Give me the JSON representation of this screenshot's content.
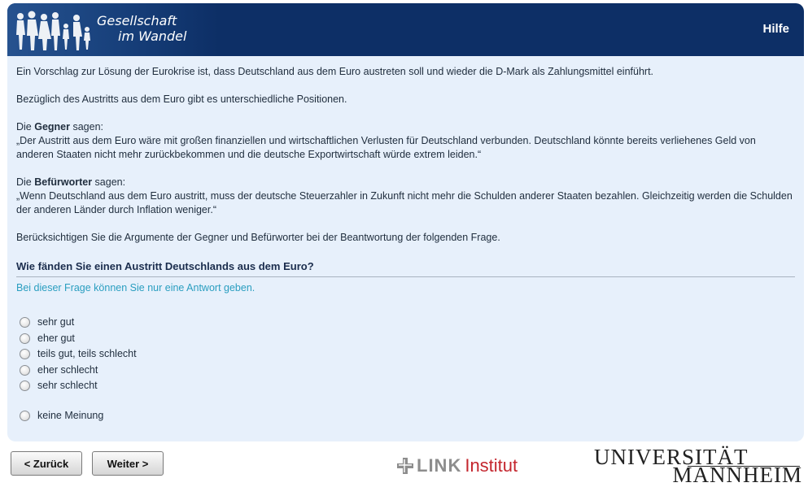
{
  "header": {
    "logo_line1": "Gesellschaft",
    "logo_line2": "im Wandel",
    "help_label": "Hilfe"
  },
  "intro": {
    "p1": "Ein Vorschlag zur Lösung der Eurokrise ist, dass Deutschland aus dem Euro austreten soll und wieder die D-Mark als Zahlungsmittel einführt.",
    "p2": "Bezüglich des Austritts aus dem Euro gibt es unterschiedliche Positionen.",
    "gegner_prefix": "Die ",
    "gegner_bold": "Gegner",
    "gegner_suffix": " sagen:",
    "gegner_quote": "„Der Austritt aus dem Euro wäre mit großen finanziellen und wirtschaftlichen Verlusten für Deutschland verbunden. Deutschland könnte bereits verliehenes Geld von anderen Staaten nicht mehr zurückbekommen und die deutsche Exportwirtschaft würde extrem leiden.“",
    "befuerworter_prefix": "Die ",
    "befuerworter_bold": "Befürworter",
    "befuerworter_suffix": " sagen:",
    "befuerworter_quote": "„Wenn Deutschland aus dem Euro austritt, muss der deutsche Steuerzahler in Zukunft nicht mehr die Schulden anderer Staaten bezahlen. Gleichzeitig werden die Schulden der anderen Länder durch Inflation weniger.“",
    "p_consider": "Berücksichtigen Sie die Argumente der Gegner und Befürworter bei der Beantwortung der folgenden Frage."
  },
  "question": {
    "text": "Wie fänden Sie einen Austritt Deutschlands aus dem Euro?",
    "hint": "Bei dieser Frage können Sie nur eine Antwort geben.",
    "options": [
      "sehr gut",
      "eher gut",
      "teils gut, teils schlecht",
      "eher schlecht",
      "sehr schlecht"
    ],
    "no_opinion": "keine Meinung"
  },
  "nav": {
    "back_label": "< Zurück",
    "next_label": "Weiter >"
  },
  "footer": {
    "link_word": "LINK",
    "link_institut": "Institut",
    "uni_line1": "UNIVERSITÄT",
    "uni_line2": "MANNHEIM"
  },
  "colors": {
    "header_bg": "#0d2f66",
    "panel_bg": "#e7f0fb",
    "hint_color": "#2a9ec0",
    "link_red": "#c4262e"
  }
}
